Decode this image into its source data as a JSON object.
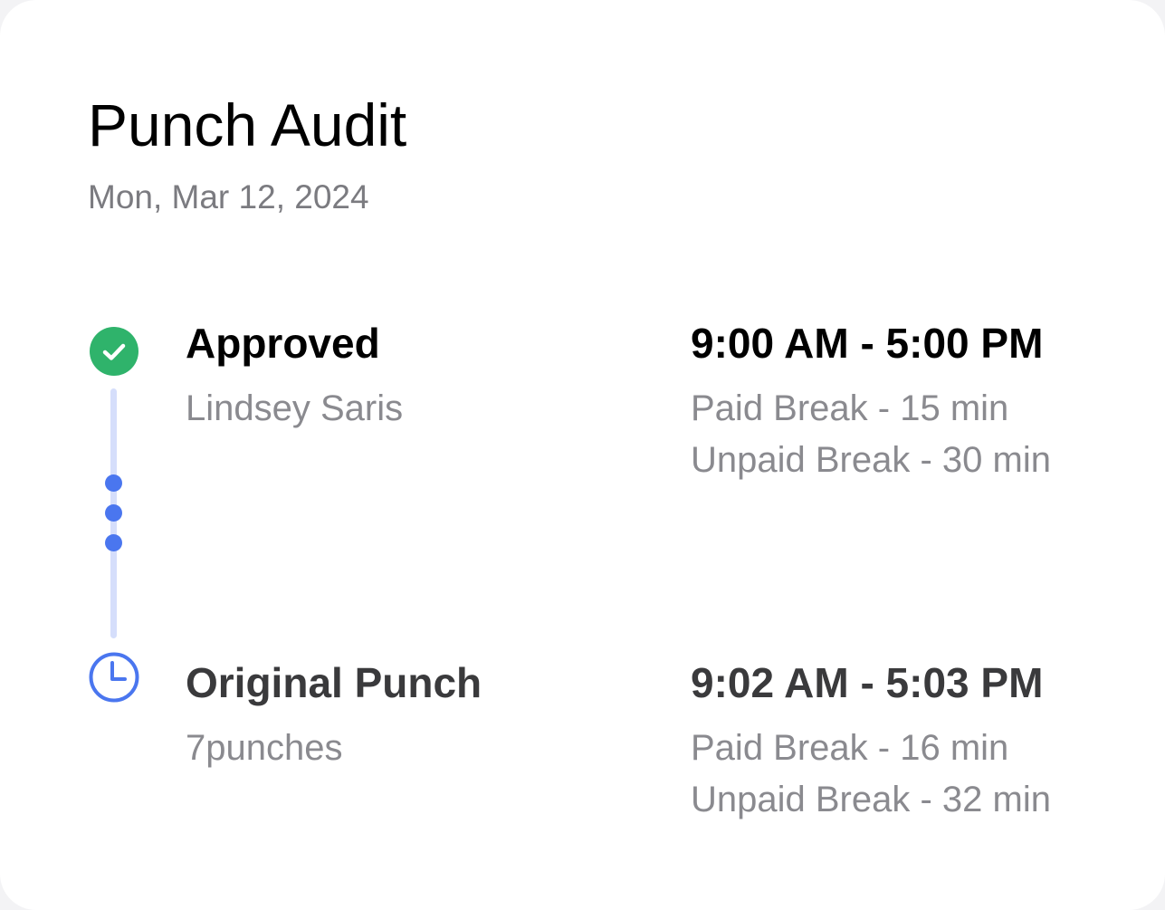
{
  "header": {
    "title": "Punch Audit",
    "date": "Mon, Mar 12, 2024"
  },
  "colors": {
    "approved_green": "#2fb36b",
    "timeline_blue": "#4a76ef",
    "timeline_line": "#d5defb",
    "muted_text": "#8a8a8f"
  },
  "entries": [
    {
      "status": "Approved",
      "actor": "Lindsey Saris",
      "time_range": "9:00 AM - 5:00 PM",
      "paid_break": "Paid Break - 15 min",
      "unpaid_break": "Unpaid Break - 30 min",
      "icon": "check-circle-icon"
    },
    {
      "status": "Original Punch",
      "actor": "7punches",
      "time_range": "9:02 AM - 5:03 PM",
      "paid_break": "Paid Break - 16 min",
      "unpaid_break": "Unpaid Break - 32 min",
      "icon": "clock-icon"
    }
  ]
}
